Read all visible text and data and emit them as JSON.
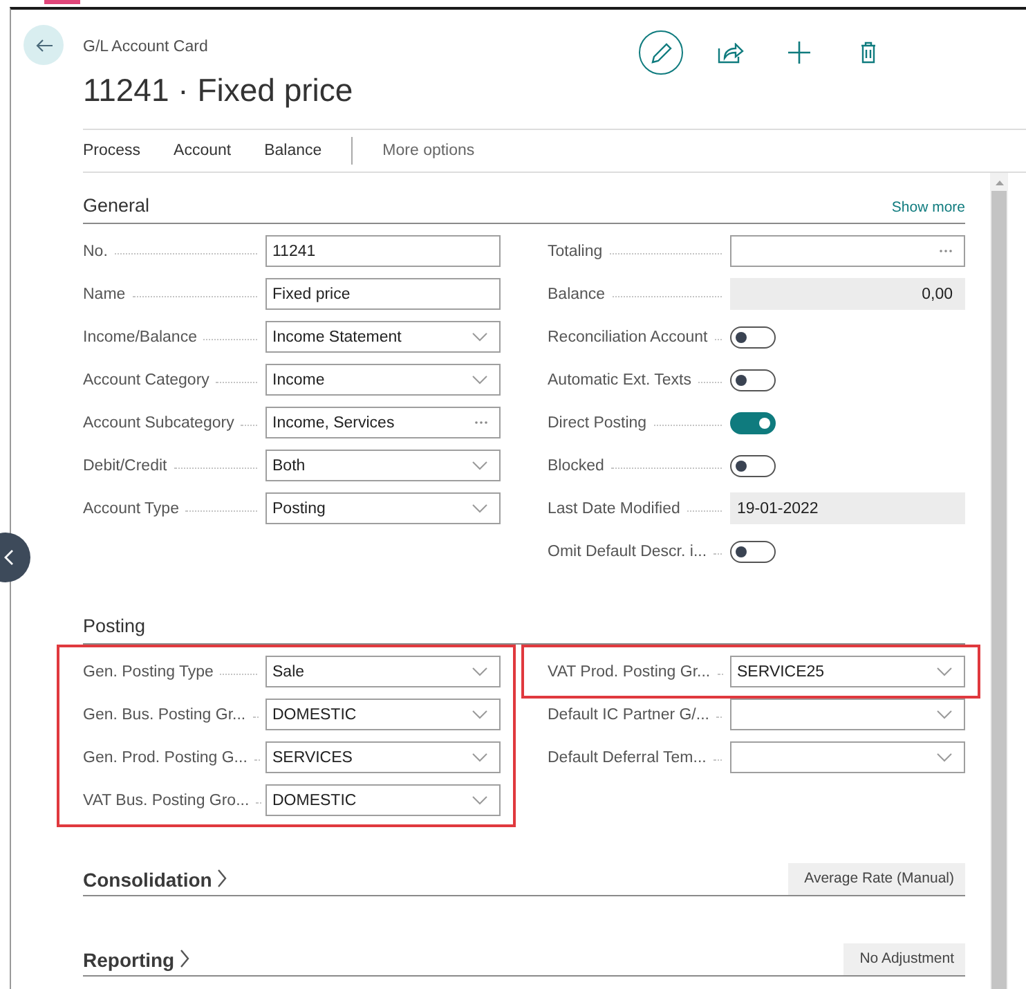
{
  "page_type": "G/L Account Card",
  "title": "11241 · Fixed price",
  "actions": [
    {
      "kind": "edit",
      "active": true
    },
    {
      "kind": "share",
      "active": false
    },
    {
      "kind": "new",
      "active": false
    },
    {
      "kind": "delete",
      "active": false
    }
  ],
  "menu": [
    {
      "label": "Process",
      "kind": "action"
    },
    {
      "label": "Account",
      "kind": "action"
    },
    {
      "label": "Balance",
      "kind": "action"
    },
    {
      "label": "More options",
      "kind": "more"
    }
  ],
  "sections": [
    {
      "title": "General",
      "expanded": true,
      "link": "Show more",
      "columns": [
        {
          "groups": [
            {
              "highlighted": false,
              "fields": [
                {
                  "label": "No.",
                  "kind": "text",
                  "value": "11241"
                },
                {
                  "label": "Name",
                  "kind": "text",
                  "value": "Fixed price"
                },
                {
                  "label": "Income/Balance",
                  "kind": "select",
                  "value": "Income Statement"
                },
                {
                  "label": "Account Category",
                  "kind": "select",
                  "value": "Income"
                },
                {
                  "label": "Account Subcategory",
                  "kind": "lookup",
                  "value": "Income, Services"
                },
                {
                  "label": "Debit/Credit",
                  "kind": "select",
                  "value": "Both"
                },
                {
                  "label": "Account Type",
                  "kind": "select",
                  "value": "Posting"
                }
              ]
            }
          ]
        },
        {
          "groups": [
            {
              "highlighted": false,
              "fields": [
                {
                  "label": "Totaling",
                  "kind": "lookup"
                },
                {
                  "label": "Balance",
                  "kind": "amount",
                  "value": "0,00"
                },
                {
                  "label": "Reconciliation Account",
                  "kind": "toggle",
                  "on": false
                },
                {
                  "label": "Automatic Ext. Texts",
                  "kind": "toggle",
                  "on": false
                },
                {
                  "label": "Direct Posting",
                  "kind": "toggle",
                  "on": true
                },
                {
                  "label": "Blocked",
                  "kind": "toggle",
                  "on": false
                },
                {
                  "label": "Last Date Modified",
                  "kind": "readonly",
                  "value": "19-01-2022"
                },
                {
                  "label": "Omit Default Descr. i...",
                  "kind": "toggle",
                  "on": false
                }
              ]
            }
          ]
        }
      ]
    },
    {
      "title": "Posting",
      "expanded": true,
      "columns": [
        {
          "groups": [
            {
              "highlighted": true,
              "fields": [
                {
                  "label": "Gen. Posting Type",
                  "kind": "select",
                  "value": "Sale"
                },
                {
                  "label": "Gen. Bus. Posting Gr...",
                  "kind": "select",
                  "value": "DOMESTIC"
                },
                {
                  "label": "Gen. Prod. Posting G...",
                  "kind": "select",
                  "value": "SERVICES"
                },
                {
                  "label": "VAT Bus. Posting Gro...",
                  "kind": "select",
                  "value": "DOMESTIC"
                }
              ]
            }
          ]
        },
        {
          "groups": [
            {
              "highlighted": true,
              "fields": [
                {
                  "label": "VAT Prod. Posting Gr...",
                  "kind": "select",
                  "value": "SERVICE25"
                }
              ]
            },
            {
              "highlighted": false,
              "fields": [
                {
                  "label": "Default IC Partner G/...",
                  "kind": "select"
                },
                {
                  "label": "Default Deferral Tem...",
                  "kind": "select"
                }
              ]
            }
          ]
        }
      ]
    },
    {
      "title": "Consolidation",
      "expanded": false,
      "summary": "Average Rate (Manual)"
    },
    {
      "title": "Reporting",
      "expanded": false,
      "summary": "No Adjustment"
    }
  ]
}
